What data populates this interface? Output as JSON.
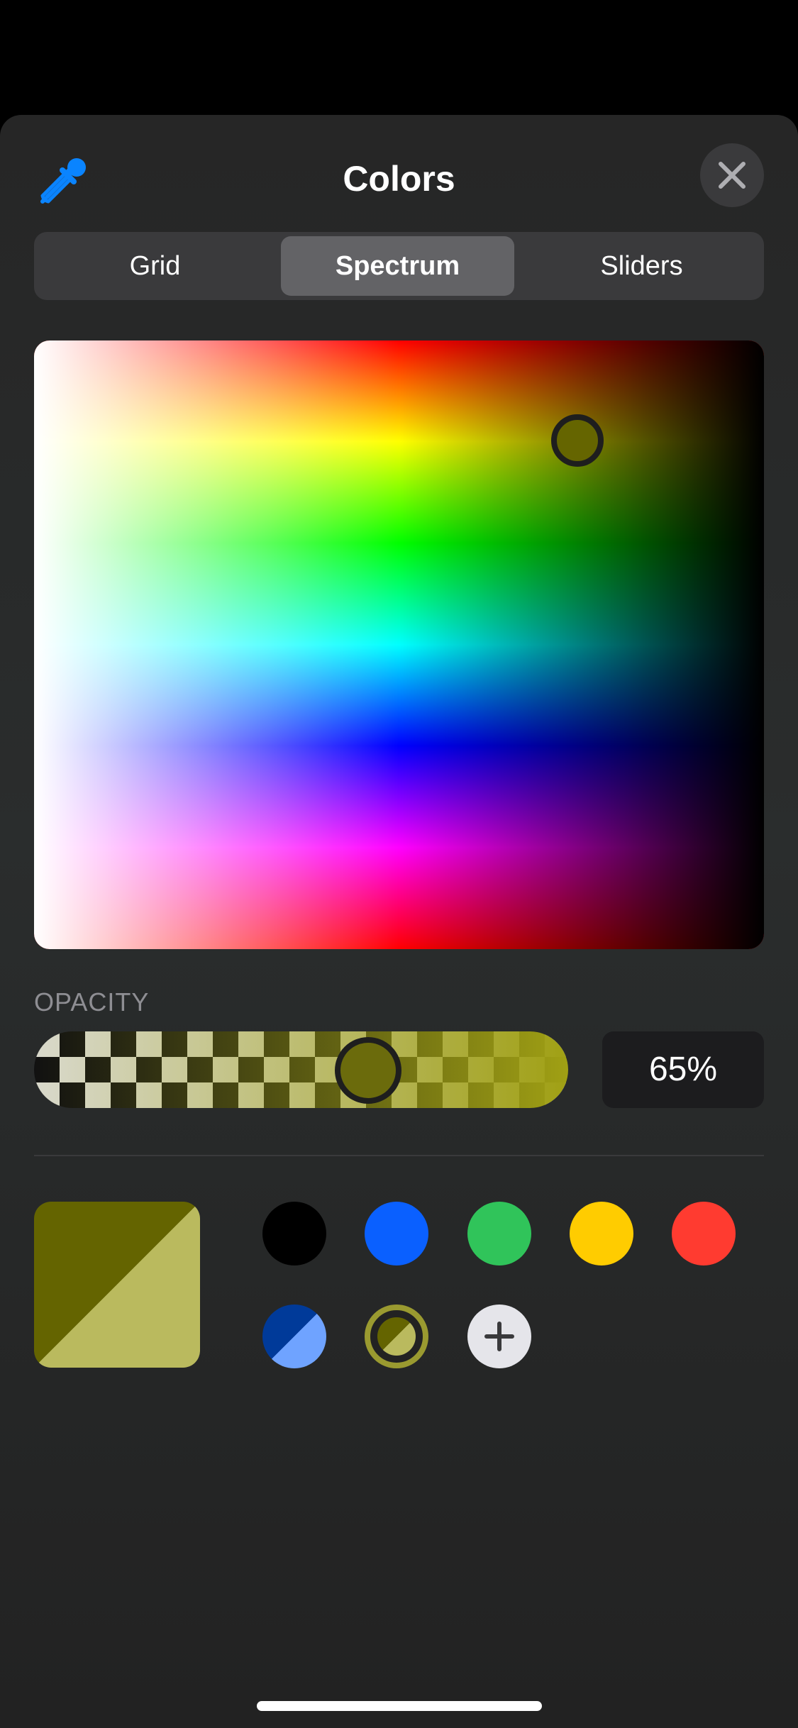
{
  "header": {
    "title": "Colors",
    "left_icon": "eyedropper-icon",
    "close_icon": "close-icon"
  },
  "tabs": [
    {
      "label": "Grid",
      "selected": false
    },
    {
      "label": "Spectrum",
      "selected": true
    },
    {
      "label": "Sliders",
      "selected": false
    }
  ],
  "opacity": {
    "label": "OPACITY",
    "value_text": "65%",
    "value": 0.65
  },
  "selected_color": "#646400",
  "swatches": [
    {
      "name": "black",
      "color": "#000000"
    },
    {
      "name": "blue",
      "color": "#0a60ff"
    },
    {
      "name": "green",
      "color": "#30c45a"
    },
    {
      "name": "yellow",
      "color": "#ffcc00"
    },
    {
      "name": "red",
      "color": "#ff3b30"
    },
    {
      "name": "dark-blue",
      "color": "#003a99"
    },
    {
      "name": "olive",
      "color": "#646400"
    }
  ],
  "add_swatch_icon": "plus-icon",
  "accent_color": "#0a84ff"
}
